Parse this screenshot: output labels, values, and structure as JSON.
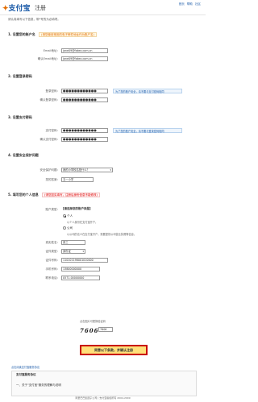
{
  "header": {
    "logo_text": "支付宝",
    "page_title": "注册",
    "top_links": [
      "首页",
      "帮助",
      "社区"
    ]
  },
  "intro": "请认真填写以下信息，带*号的为必填项。",
  "step1": {
    "title": "1. 设置您的账户名",
    "tip": "(请您使用常用的电子邮件地址作为账户名)",
    "email_label": "Email地址：",
    "email_value": "jane09@fakex.com.cn",
    "email_confirm_label": "确认Email地址：",
    "email_confirm_value": "jane09@fakex.com.cn"
  },
  "step2": {
    "title": "2. 设置登录密码",
    "pwd_label": "登录密码：",
    "pwd_value": "●●●●●●●●●●●●",
    "pwd_confirm_label": "确认登录密码：",
    "pwd_confirm_value": "●●●●●●●●●●●●",
    "note": "为了您的账户安全，请不要与支付密码相同"
  },
  "step3": {
    "title": "3. 设置支付密码",
    "pwd_label": "支付密码：",
    "pwd_value": "●●●●●●●●●●●●",
    "pwd_confirm_label": "确认支付密码：",
    "pwd_confirm_value": "●●●●●●●●●●●●",
    "note": "为了您的账户安全，请不要与登录密码相同"
  },
  "step4": {
    "title": "4. 设置安全保护问题",
    "question_label": "安全保护问题：",
    "question_value": "我的小学校名是什么？",
    "answer_label": "您的答案：",
    "answer_value": "五一小学"
  },
  "step5": {
    "title": "5. 填写您的个人信息",
    "tip": "(请您如实填写，注册后身份信息不能修改)",
    "type_label": "账户类型：",
    "type_question": "【请选择您的账户类型】",
    "type_personal": "个人",
    "type_personal_desc": "以个人身份在支付宝开户。",
    "type_company": "公司",
    "type_company_desc": "以公司的名义在支付宝开户，需要提供公司营业执照等信息。",
    "name_label": "真实姓名：",
    "name_value": "张三",
    "id_type_label": "证件类型：",
    "id_type_value": "身份证",
    "id_number_label": "证件号码：",
    "id_number_value": "110101198001010000",
    "mobile_label": "手机号码：",
    "mobile_value": "13800000000",
    "phone_label": "联系电话：",
    "phone_value": "0571-00000000"
  },
  "captcha": {
    "hint": "点击图片可更换验证码",
    "value": "7606",
    "input_value": "7606"
  },
  "submit_label": "同意以下条款，并确认注册",
  "agreement": {
    "link": "点击阅读支付宝服务协议",
    "title": "支付宝服务协议",
    "line": "一、关于\"支付宝\"服务的理解与说明"
  },
  "footer": "阿里巴巴集团子公司 | 支付宝版权所有 2004-2009"
}
